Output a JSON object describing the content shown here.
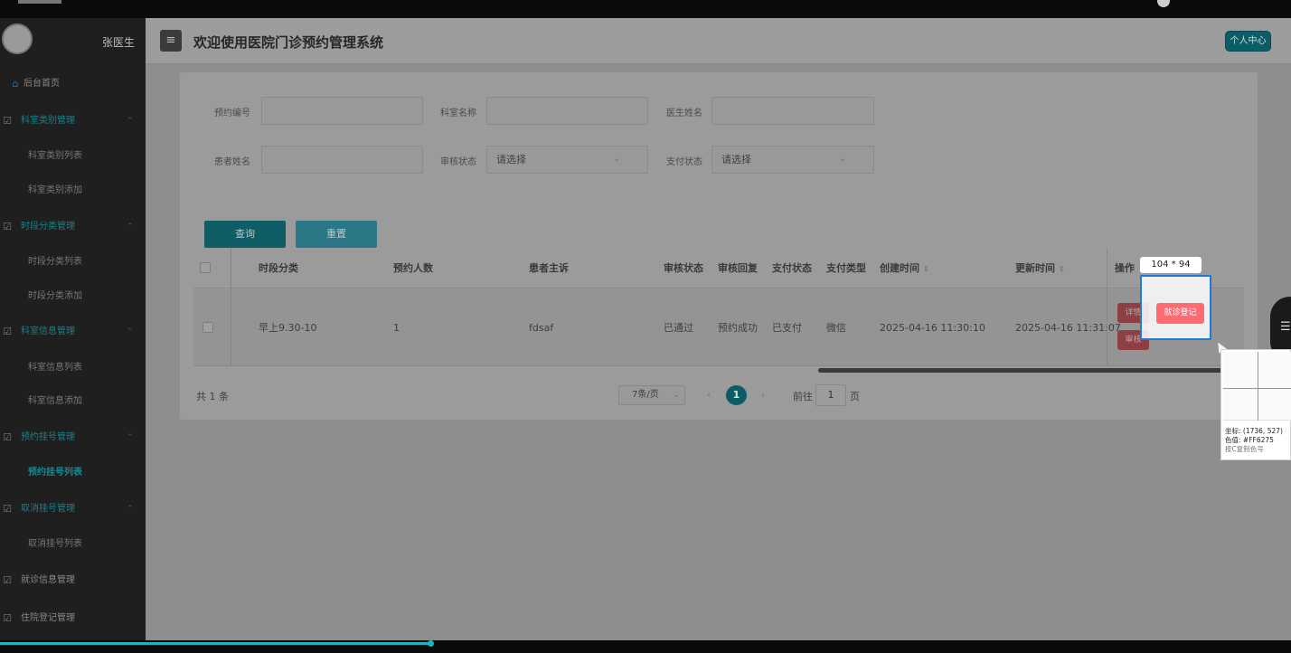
{
  "sidebar": {
    "user_name": "张医生",
    "items": [
      {
        "label": "后台首页",
        "type": "home"
      },
      {
        "label": "科室类别管理",
        "type": "group"
      },
      {
        "label": "科室类别列表",
        "type": "sub"
      },
      {
        "label": "科室类别添加",
        "type": "sub"
      },
      {
        "label": "时段分类管理",
        "type": "group"
      },
      {
        "label": "时段分类列表",
        "type": "sub"
      },
      {
        "label": "时段分类添加",
        "type": "sub"
      },
      {
        "label": "科室信息管理",
        "type": "group"
      },
      {
        "label": "科室信息列表",
        "type": "sub"
      },
      {
        "label": "科室信息添加",
        "type": "sub"
      },
      {
        "label": "预约挂号管理",
        "type": "group"
      },
      {
        "label": "预约挂号列表",
        "type": "active"
      },
      {
        "label": "取消挂号管理",
        "type": "group"
      },
      {
        "label": "取消挂号列表",
        "type": "sub"
      },
      {
        "label": "就诊信息管理",
        "type": "plain"
      },
      {
        "label": "住院登记管理",
        "type": "plain"
      }
    ]
  },
  "header": {
    "menu_icon": "≡",
    "title": "欢迎使用医院门诊预约管理系统",
    "profile_button": "个人中心"
  },
  "filters": {
    "appointment_no_label": "预约编号",
    "department_name_label": "科室名称",
    "doctor_name_label": "医生姓名",
    "patient_name_label": "患者姓名",
    "review_status_label": "审核状态",
    "review_status_value": "请选择",
    "pay_status_label": "支付状态",
    "pay_status_value": "请选择",
    "query_button": "查询",
    "reset_button": "重置"
  },
  "table": {
    "columns": {
      "time_slot": "时段分类",
      "count": "预约人数",
      "complaint": "患者主诉",
      "review_status": "审核状态",
      "review_reply": "审核回复",
      "pay_status": "支付状态",
      "pay_type": "支付类型",
      "created": "创建时间",
      "updated": "更新时间",
      "actions": "操作"
    },
    "rows": [
      {
        "time_slot": "早上9.30-10",
        "count": "1",
        "complaint": "fdsaf",
        "review_status": "已通过",
        "review_reply": "预约成功",
        "pay_status": "已支付",
        "pay_type": "微信",
        "created": "2025-04-16 11:30:10",
        "updated": "2025-04-16 11:31:07",
        "actions": {
          "detail": "详情",
          "visit_register": "就诊登记",
          "review": "审核"
        }
      }
    ]
  },
  "pagination": {
    "total": "共 1 条",
    "page_size": "7条/页",
    "current_page": "1",
    "goto_label": "前往",
    "goto_value": "1",
    "page_suffix": "页"
  },
  "overlay": {
    "dimensions": "104 * 94",
    "coord": "坐标: (1736, 527)",
    "color_value": "色值: #FF6275",
    "copy_hint": "按C复制色号"
  },
  "colors": {
    "accent": "#0f5e67",
    "danger": "#ff6a73",
    "selection": "#1e7bd7"
  },
  "icons": {
    "sort": "sort-icon",
    "dropdown": "chevron-down-icon",
    "home": "home-icon",
    "group": "edit-icon"
  }
}
